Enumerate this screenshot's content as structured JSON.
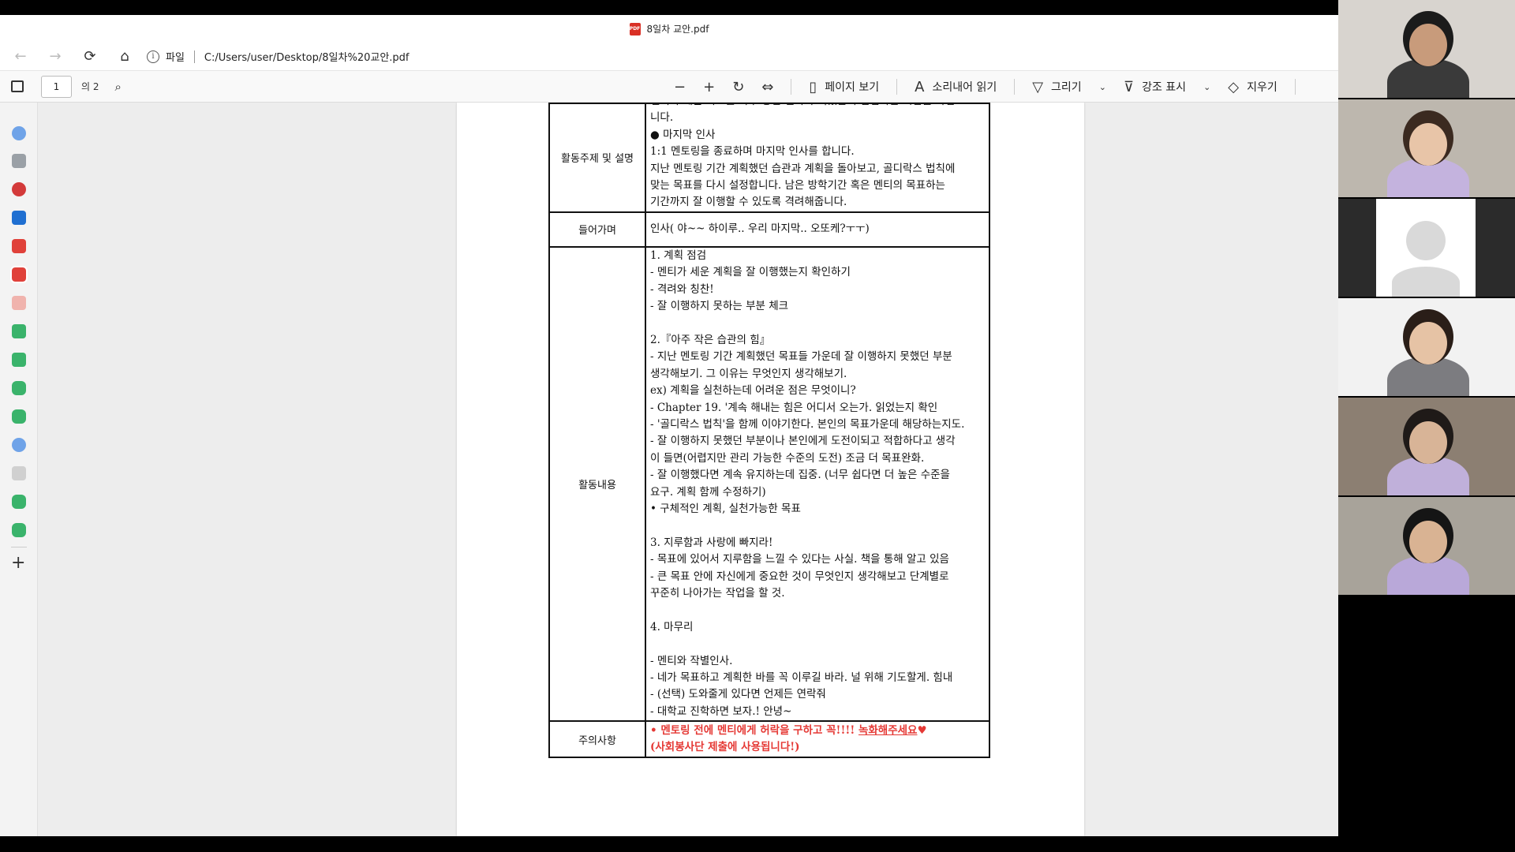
{
  "window": {
    "title": "8일차 교안.pdf",
    "pdf_badge": "PDF"
  },
  "address": {
    "prefix": "파일",
    "url": "C:/Users/user/Desktop/8일차%20교안.pdf"
  },
  "toolbar": {
    "page_current": "1",
    "page_total": "의 2",
    "page_view": "페이지 보기",
    "read_aloud": "소리내어 읽기",
    "draw": "그리기",
    "highlight": "강조 표시",
    "erase": "지우기"
  },
  "document": {
    "rows": [
      {
        "label": "활동주제 및 설명",
        "lines": [
          "멘티가 세운 목표를 하루 동안 얼마나 이뤘는지 점검하는 시간을 가집",
          "니다.",
          "● 마지막 인사",
          "1:1 멘토링을 종료하며 마지막 인사를 합니다.",
          "지난 멘토링 기간 계획했던 습관과 계획을 돌아보고, 골디락스 법칙에",
          "맞는 목표를 다시 설정합니다. 남은 방학기간 혹은 멘티의 목표하는",
          "기간까지 잘 이행할 수 있도록 격려해줍니다."
        ]
      },
      {
        "label": "들어가며",
        "lines": [
          "인사( 야~~ 하이루.. 우리 마지막.. 오또케?ㅜㅜ)"
        ]
      },
      {
        "label": "활동내용",
        "lines": [
          "1. 계획 점검",
          "- 멘티가 세운 계획을 잘 이행했는지 확인하기",
          "- 격려와 칭찬!",
          "- 잘 이행하지 못하는 부분 체크",
          "",
          "2.『아주 작은 습관의 힘』",
          "- 지난 멘토링 기간 계획했던 목표들 가운데 잘 이행하지 못했던 부분",
          "생각해보기. 그 이유는 무엇인지 생각해보기.",
          "ex) 계획을 실천하는데 어려운 점은 무엇이니?",
          "- Chapter 19. '계속 해내는 힘은 어디서 오는가. 읽었는지 확인",
          "- '골디락스 법칙'을 함께 이야기한다. 본인의 목표가운데 해당하는지도.",
          "- 잘 이행하지 못했던 부분이나 본인에게 도전이되고 적합하다고 생각",
          "이 들면(어렵지만 관리 가능한 수준의 도전) 조금 더 목표완화.",
          "- 잘 이행했다면 계속 유지하는데 집중. (너무 쉽다면 더 높은 수준을",
          "요구. 계획 함께 수정하기)",
          "• 구체적인 계획, 실천가능한 목표",
          "",
          "3. 지루함과 사랑에 빠지라!",
          "- 목표에 있어서 지루함을 느낄 수 있다는 사실. 책을 통해 알고 있음",
          "- 큰 목표 안에 자신에게 중요한 것이 무엇인지 생각해보고 단계별로",
          "꾸준히 나아가는 작업을 할 것.",
          "",
          "4. 마무리",
          "",
          "- 멘티와 작별인사.",
          "- 네가 목표하고 계획한 바를 꼭 이루길 바라. 널 위해 기도할게. 힘내",
          "- (선택) 도와줄게 있다면 언제든 연락줘",
          "- 대학교 진학하면 보자.! 안녕~"
        ]
      },
      {
        "label": "주의사항",
        "line1_text": "• 멘토링 전에 멘티에게 허락을 구하고 꼭!!!! ",
        "line1_underlined": "녹화해주세요",
        "line1_heart": "♥",
        "line2": "(사회봉사단 제출에 사용됩니다!)"
      }
    ]
  },
  "colors": {
    "warning_text": "#e53935",
    "pdf_red": "#d93025"
  },
  "participants": [
    {
      "name": "participant-1",
      "bg": "#d8d4cf",
      "skin": "#c89b7b",
      "hair": "#1b1b1b",
      "shirt": "#3a3a3a"
    },
    {
      "name": "participant-2",
      "bg": "#bdb7ae",
      "skin": "#e8c5a8",
      "hair": "#3b2a20",
      "shirt": "#c4b3de"
    },
    {
      "name": "participant-3",
      "bg": "#2b2b2b",
      "skin": "#d9d9d9",
      "hair": "#d9d9d9",
      "shirt": "#d9d9d9"
    },
    {
      "name": "participant-4",
      "bg": "#f2f2f2",
      "skin": "#e6c3a5",
      "hair": "#2a1e18",
      "shirt": "#7c7c80"
    },
    {
      "name": "participant-5",
      "bg": "#8c7f72",
      "skin": "#d8b497",
      "hair": "#1f1a18",
      "shirt": "#c0b0da"
    },
    {
      "name": "participant-6",
      "bg": "#a8a39a",
      "skin": "#d9b393",
      "hair": "#151515",
      "shirt": "#b9a8d9"
    }
  ]
}
